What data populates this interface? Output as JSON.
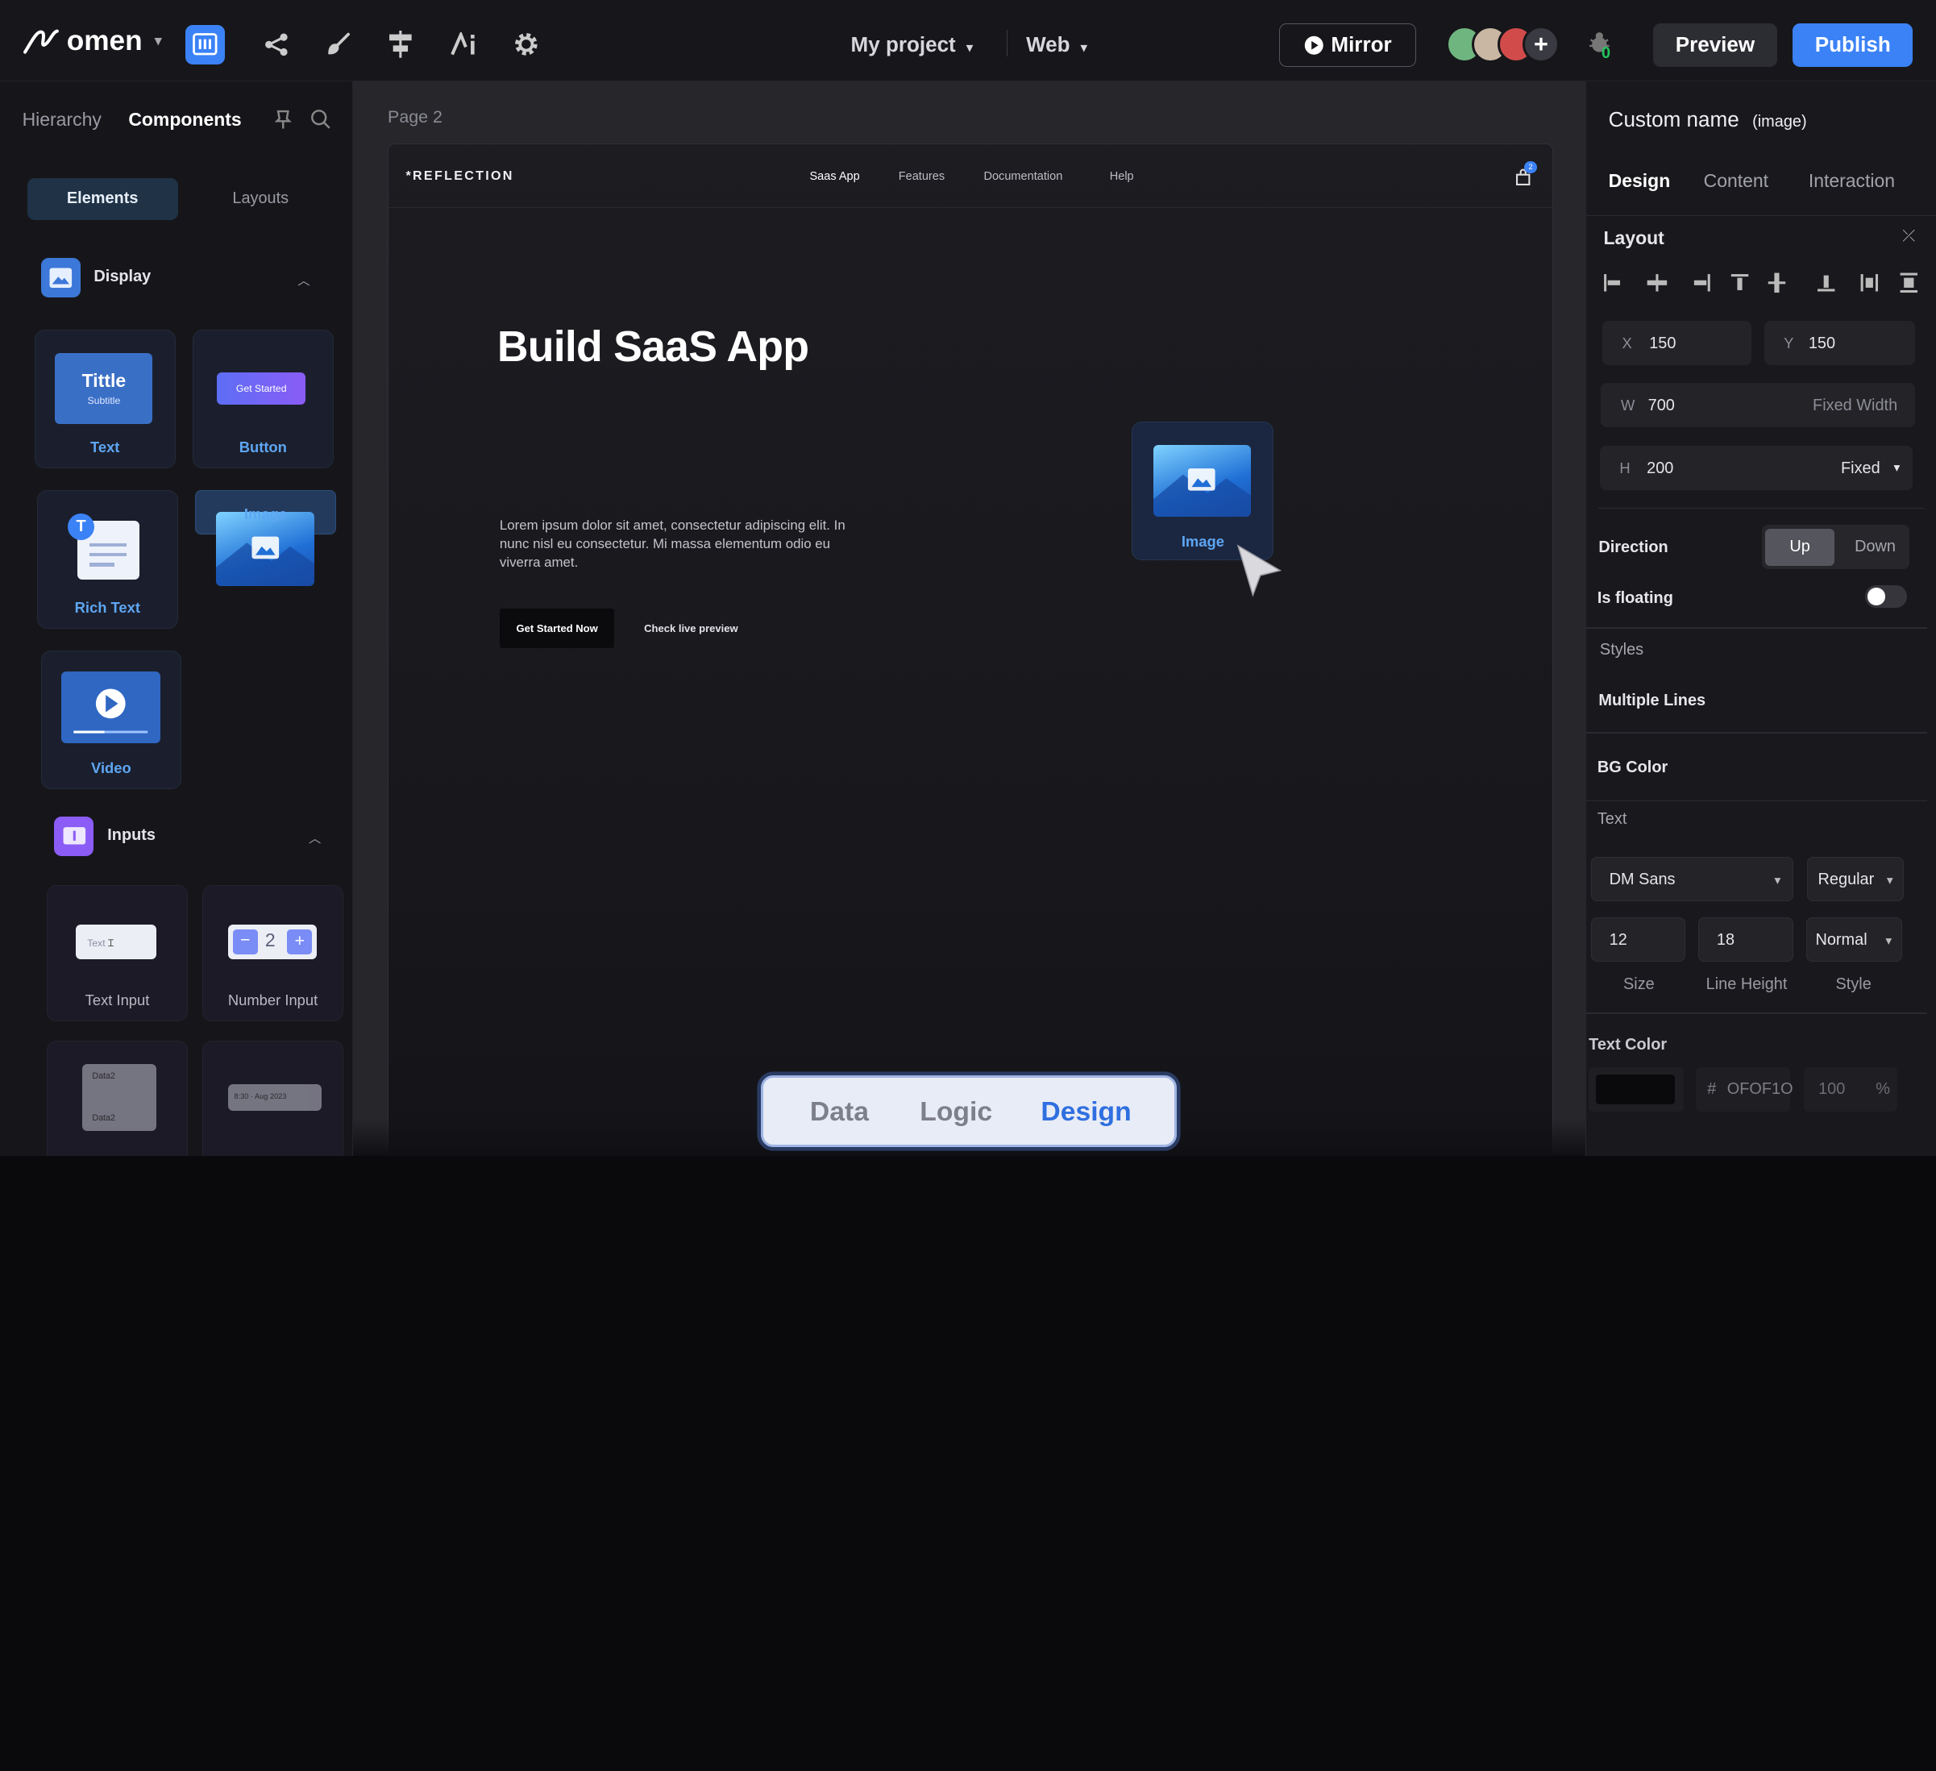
{
  "topbar": {
    "logo_text": "omen",
    "project": "My project",
    "platform": "Web",
    "mirror_label": "Mirror",
    "notification_count": "0",
    "preview_label": "Preview",
    "publish_label": "Publish"
  },
  "left_panel": {
    "tabs": [
      "Hierarchy",
      "Components"
    ],
    "segments": [
      "Elements",
      "Layouts"
    ],
    "display_section": "Display",
    "display_items": [
      "Text",
      "Button",
      "Rich Text",
      "Image",
      "Video"
    ],
    "text_thumb_title": "Tittle",
    "text_thumb_subtitle": "Subtitle",
    "button_thumb": "Get Started",
    "inputs_section": "Inputs",
    "input_items": [
      "Text Input",
      "Number Input"
    ],
    "text_input_thumb": "Text",
    "number_input_value": "2",
    "date_thumb": [
      "Data2",
      "Data2"
    ],
    "date_time_thumb": "8:30 · Aug 2023"
  },
  "canvas": {
    "page_label": "Page 2",
    "brand": "*REFLECTION",
    "nav_links": [
      "Saas App",
      "Features",
      "Documentation",
      "Help"
    ],
    "cart_badge": "2",
    "hero_title": "Build SaaS App",
    "lorem": "Lorem ipsum dolor sit amet, consectetur adipiscing elit. In nunc nisl eu consectetur. Mi massa elementum odio eu viverra amet.",
    "primary_cta": "Get Started Now",
    "secondary_cta": "Check live preview",
    "dragged_item": "Image"
  },
  "mode_switch": {
    "options": [
      "Data",
      "Logic",
      "Design"
    ],
    "active": "Design"
  },
  "right_panel": {
    "title": "Custom name",
    "title_suffix": "(image)",
    "tabs": [
      "Design",
      "Content",
      "Interaction"
    ],
    "layout_label": "Layout",
    "x_label": "X",
    "x": "150",
    "y_label": "Y",
    "y": "150",
    "w_label": "W",
    "w": "700",
    "w_mode": "Fixed Width",
    "h_label": "H",
    "h": "200",
    "h_mode": "Fixed",
    "direction_label": "Direction",
    "direction_options": [
      "Up",
      "Down"
    ],
    "floating_label": "Is floating",
    "floating": false,
    "styles_label": "Styles",
    "multiple_lines": "Multiple Lines",
    "bg_color": "BG Color",
    "text_label": "Text",
    "font": "DM Sans",
    "weight": "Regular",
    "size": "12",
    "line_height": "18",
    "style": "Normal",
    "size_caption": "Size",
    "lh_caption": "Line Height",
    "style_caption": "Style",
    "text_color_label": "Text Color",
    "text_color_hash": "#",
    "text_color_hex": "OFOF1O",
    "text_color_opacity": "100",
    "opacity_unit": "%"
  },
  "colors": {
    "accent": "#3b82f6",
    "panel": "#16161a",
    "canvas": "#26262b"
  }
}
